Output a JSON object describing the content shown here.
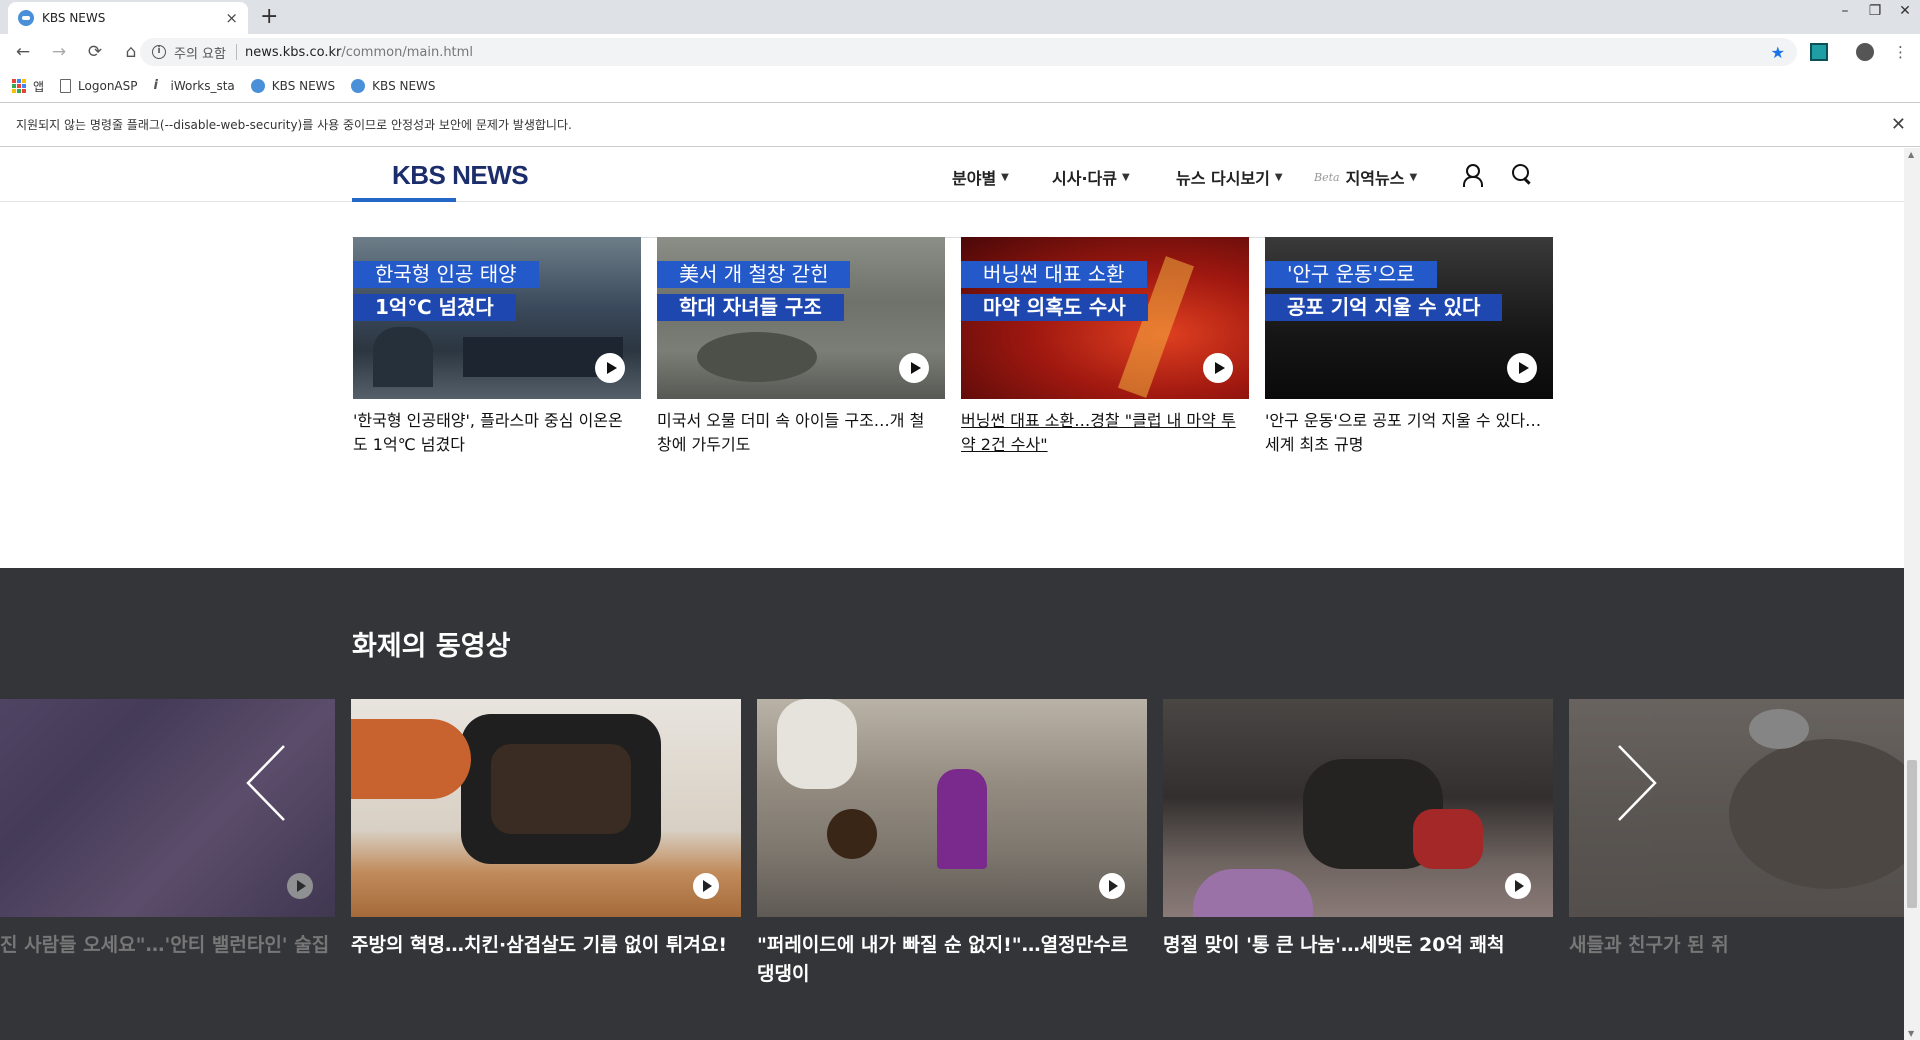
{
  "browser": {
    "tab_title": "KBS NEWS",
    "tab_close": "×",
    "new_tab": "+",
    "window_controls": [
      "–",
      "❐",
      "✕"
    ],
    "nav": {
      "back": "←",
      "forward": "→",
      "reload": "⟳",
      "home": "⌂"
    },
    "security_warning": "주의 요함",
    "url_host": "news.kbs.co.kr",
    "url_path": "/common/main.html",
    "star": "★",
    "menu": "⋮",
    "bookmarks": [
      {
        "label": "앱",
        "icon": "apps-icon"
      },
      {
        "label": "LogonASP",
        "icon": "document-icon"
      },
      {
        "label": "iWorks_sta",
        "icon": "iworks-icon"
      },
      {
        "label": "KBS NEWS",
        "icon": "kbs-icon"
      },
      {
        "label": "KBS NEWS",
        "icon": "kbs-icon"
      }
    ],
    "infobar_text": "지원되지 않는 명령줄 플래그(--disable-web-security)를 사용 중이므로 안정성과 보안에 문제가 발생합니다.",
    "infobar_close": "✕",
    "scroll_up": "▲",
    "scroll_down": "▼"
  },
  "header": {
    "logo": "KBS NEWS",
    "menu": [
      {
        "label": "분야별"
      },
      {
        "label": "시사·다큐"
      },
      {
        "label": "뉴스 다시보기"
      },
      {
        "beta": "Beta",
        "label": "지역뉴스"
      }
    ],
    "caret": "▼"
  },
  "news_grid": [
    {
      "cap1": "한국형 인공 태양",
      "cap2": "1억℃ 넘겼다",
      "title": "'한국형 인공태양', 플라스마 중심 이온온도 1억℃ 넘겼다"
    },
    {
      "cap1": "美서 개 철창 갇힌",
      "cap2": "학대 자녀들 구조",
      "title": "미국서 오물 더미 속 아이들 구조…개 철창에 가두기도"
    },
    {
      "cap1": "버닝썬 대표 소환",
      "cap2": "마약 의혹도 수사",
      "title": "버닝썬 대표 소환…경찰 \"클럽 내 마약 투약 2건 수사\""
    },
    {
      "cap1": "'안구 운동'으로",
      "cap2": "공포 기억 지울 수 있다",
      "title": "'안구 운동'으로 공포 기억 지울 수 있다…세계 최초 규명"
    }
  ],
  "video_section": {
    "title": "화제의 동영상",
    "items": [
      {
        "title": "진 사람들 오세요\"…'안티 밸런타인' 술집"
      },
      {
        "title": "주방의 혁명…치킨·삼겹살도 기름 없이 튀겨요!"
      },
      {
        "title": "\"퍼레이드에 내가 빠질 순 없지!\"…열정만수르 댕댕이"
      },
      {
        "title": "명절 맞이 '통 큰 나눔'…세뱃돈 20억 쾌척"
      },
      {
        "title": "새들과 친구가 된 쥐"
      }
    ]
  }
}
